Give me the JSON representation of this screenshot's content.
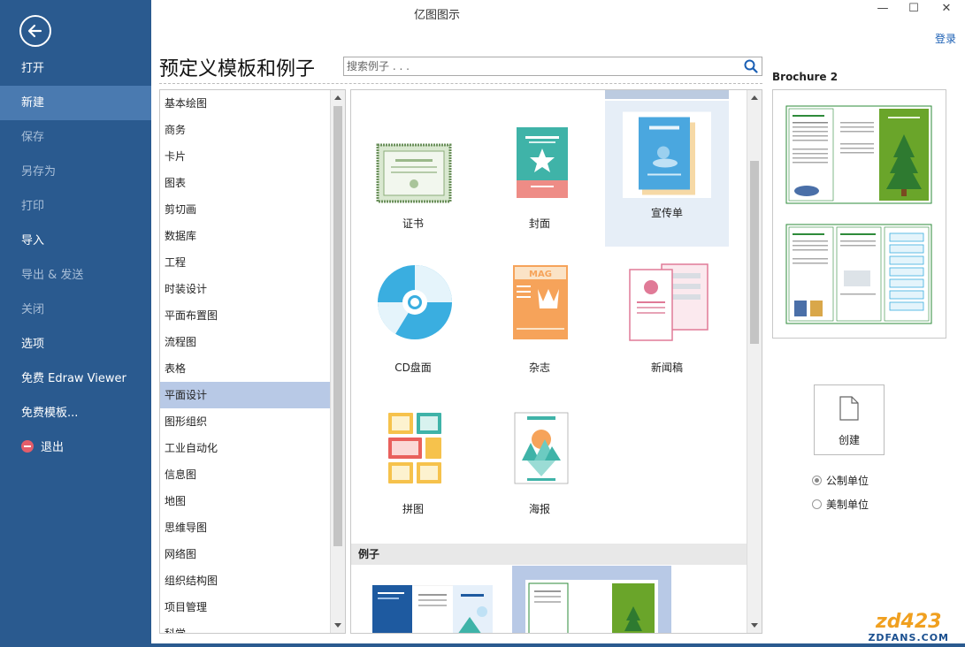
{
  "window": {
    "title": "亿图图示",
    "login": "登录",
    "minimize": "—",
    "maximize": "☐",
    "close": "✕"
  },
  "sidebar": {
    "items": [
      {
        "label": "打开",
        "state": "normal"
      },
      {
        "label": "新建",
        "state": "active"
      },
      {
        "label": "保存",
        "state": "disabled"
      },
      {
        "label": "另存为",
        "state": "disabled"
      },
      {
        "label": "打印",
        "state": "disabled"
      },
      {
        "label": "导入",
        "state": "normal"
      },
      {
        "label": "导出 & 发送",
        "state": "disabled"
      },
      {
        "label": "关闭",
        "state": "disabled"
      },
      {
        "label": "选项",
        "state": "normal"
      },
      {
        "label": "免费 Edraw Viewer",
        "state": "normal"
      },
      {
        "label": "免费模板...",
        "state": "normal"
      },
      {
        "label": "退出",
        "state": "normal"
      }
    ]
  },
  "header": {
    "title": "预定义模板和例子",
    "search_placeholder": "搜索例子 . . ."
  },
  "categories": [
    "基本绘图",
    "商务",
    "卡片",
    "图表",
    "剪切画",
    "数据库",
    "工程",
    "时装设计",
    "平面布置图",
    "流程图",
    "表格",
    "平面设计",
    "图形组织",
    "工业自动化",
    "信息图",
    "地图",
    "思维导图",
    "网络图",
    "组织结构图",
    "项目管理",
    "科学"
  ],
  "selected_category": "平面设计",
  "templates": [
    "证书",
    "封面",
    "宣传单",
    "CD盘面",
    "杂志",
    "新闻稿",
    "拼图",
    "海报"
  ],
  "selected_template": "宣传单",
  "examples_header": "例子",
  "preview": {
    "title": "Brochure 2",
    "create_label": "创建"
  },
  "units": {
    "metric": "公制单位",
    "imperial": "美制单位",
    "selected": "metric"
  },
  "thumb_text": {
    "magazine": "MAG"
  },
  "watermark": {
    "top": "zd423",
    "bottom": "ZDFANS.COM"
  },
  "colors": {
    "sidebar": "#2a5a8f",
    "sidebar_active": "#4a7ab0",
    "selection": "#b8c9e6",
    "accent_teal": "#3fb3a8",
    "accent_green": "#6aa52a"
  }
}
